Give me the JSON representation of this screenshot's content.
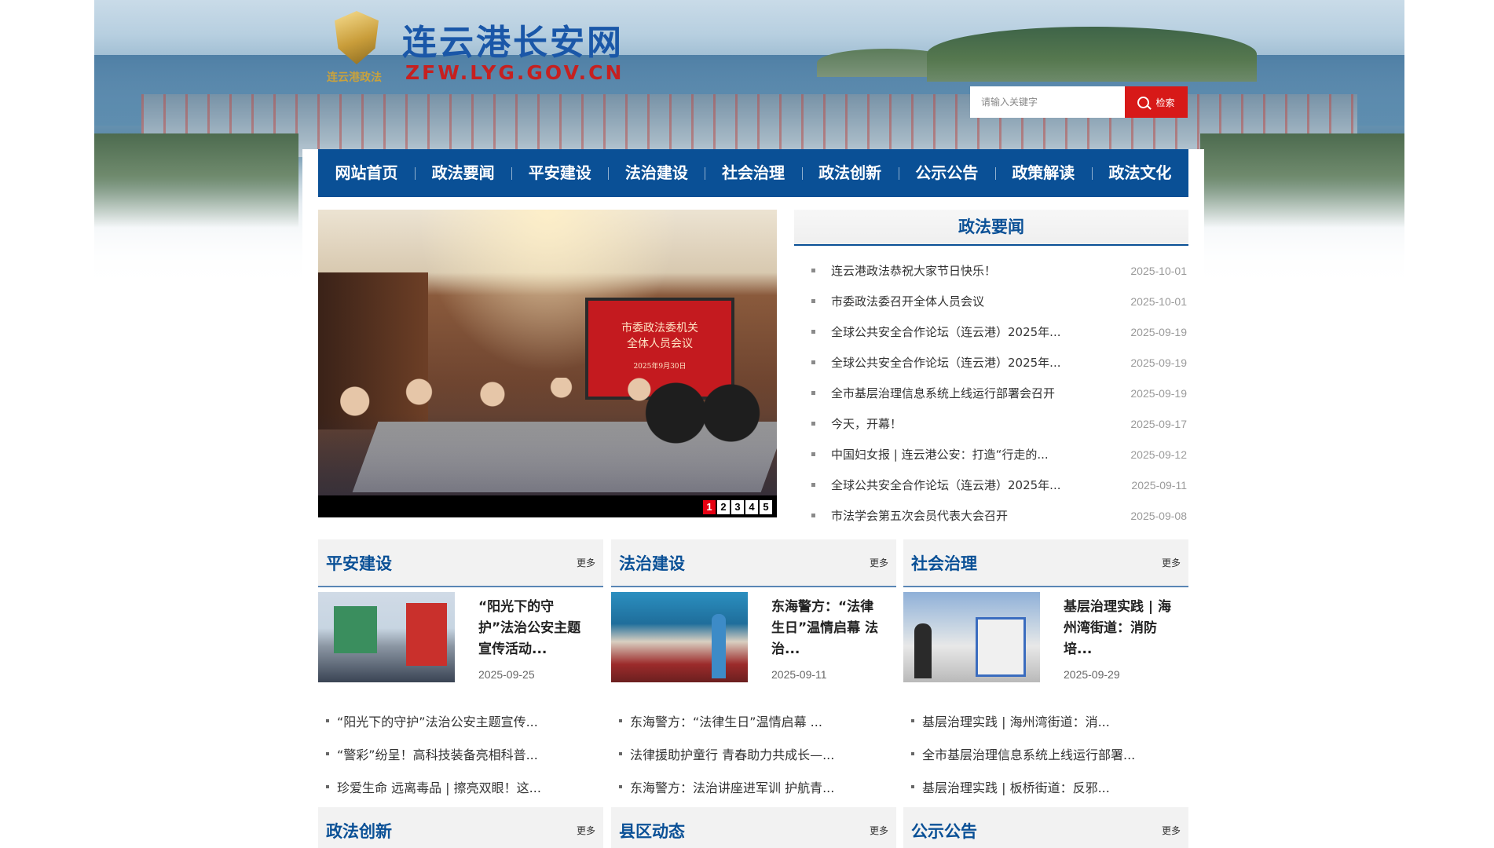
{
  "header": {
    "site_title": "连云港长安网",
    "domain": "ZFW.LYG.GOV.CN",
    "emblem_sub": "连云港政法"
  },
  "search": {
    "placeholder": "请输入关键字",
    "button_label": "检索",
    "icon": "search-icon"
  },
  "nav": {
    "items": [
      "网站首页",
      "政法要闻",
      "平安建设",
      "法治建设",
      "社会治理",
      "政法创新",
      "公示公告",
      "政策解读",
      "政法文化"
    ]
  },
  "slider": {
    "screen_line1": "市委政法委机关",
    "screen_line2": "全体人员会议",
    "screen_line3": "2025年9月30日",
    "pages": [
      "1",
      "2",
      "3",
      "4",
      "5"
    ],
    "active_page": "1"
  },
  "news": {
    "title": "政法要闻",
    "items": [
      {
        "title": "连云港政法恭祝大家节日快乐！",
        "date": "2025-10-01"
      },
      {
        "title": "市委政法委召开全体人员会议",
        "date": "2025-10-01"
      },
      {
        "title": "全球公共安全合作论坛（连云港）2025年...",
        "date": "2025-09-19"
      },
      {
        "title": "全球公共安全合作论坛（连云港）2025年...",
        "date": "2025-09-19"
      },
      {
        "title": "全市基层治理信息系统上线运行部署会召开",
        "date": "2025-09-19"
      },
      {
        "title": "今天，开幕！",
        "date": "2025-09-17"
      },
      {
        "title": "中国妇女报 | 连云港公安：打造“行走的...",
        "date": "2025-09-12"
      },
      {
        "title": "全球公共安全合作论坛（连云港）2025年...",
        "date": "2025-09-11"
      },
      {
        "title": "市法学会第五次会员代表大会召开",
        "date": "2025-09-08"
      }
    ]
  },
  "columns": [
    {
      "title": "平安建设",
      "more": "更多",
      "feature": {
        "title": "“阳光下的守护”法治公安主题宣传活动...",
        "date": "2025-09-25"
      },
      "items": [
        "“阳光下的守护”法治公安主题宣传...",
        "“警彩”纷呈！高科技装备亮相科普...",
        "珍爱生命 远离毒品 | 擦亮双眼！这..."
      ]
    },
    {
      "title": "法治建设",
      "more": "更多",
      "feature": {
        "title": "东海警方：“法律生日”温情启幕 法治...",
        "date": "2025-09-11"
      },
      "items": [
        "东海警方：“法律生日”温情启幕 ...",
        "法律援助护童行 青春助力共成长—...",
        "东海警方：法治讲座进军训 护航青..."
      ]
    },
    {
      "title": "社会治理",
      "more": "更多",
      "feature": {
        "title": "基层治理实践 | 海州湾街道：消防培...",
        "date": "2025-09-29"
      },
      "items": [
        "基层治理实践 | 海州湾街道：消...",
        "全市基层治理信息系统上线运行部署...",
        "基层治理实践 | 板桥街道：反邪..."
      ]
    }
  ],
  "bottom_columns": [
    {
      "title": "政法创新",
      "more": "更多"
    },
    {
      "title": "县区动态",
      "more": "更多"
    },
    {
      "title": "公示公告",
      "more": "更多"
    }
  ],
  "colors": {
    "nav_bg": "#0a5096",
    "accent_red": "#d71918",
    "title_blue": "#1a57a8",
    "domain_red": "#c62020"
  }
}
